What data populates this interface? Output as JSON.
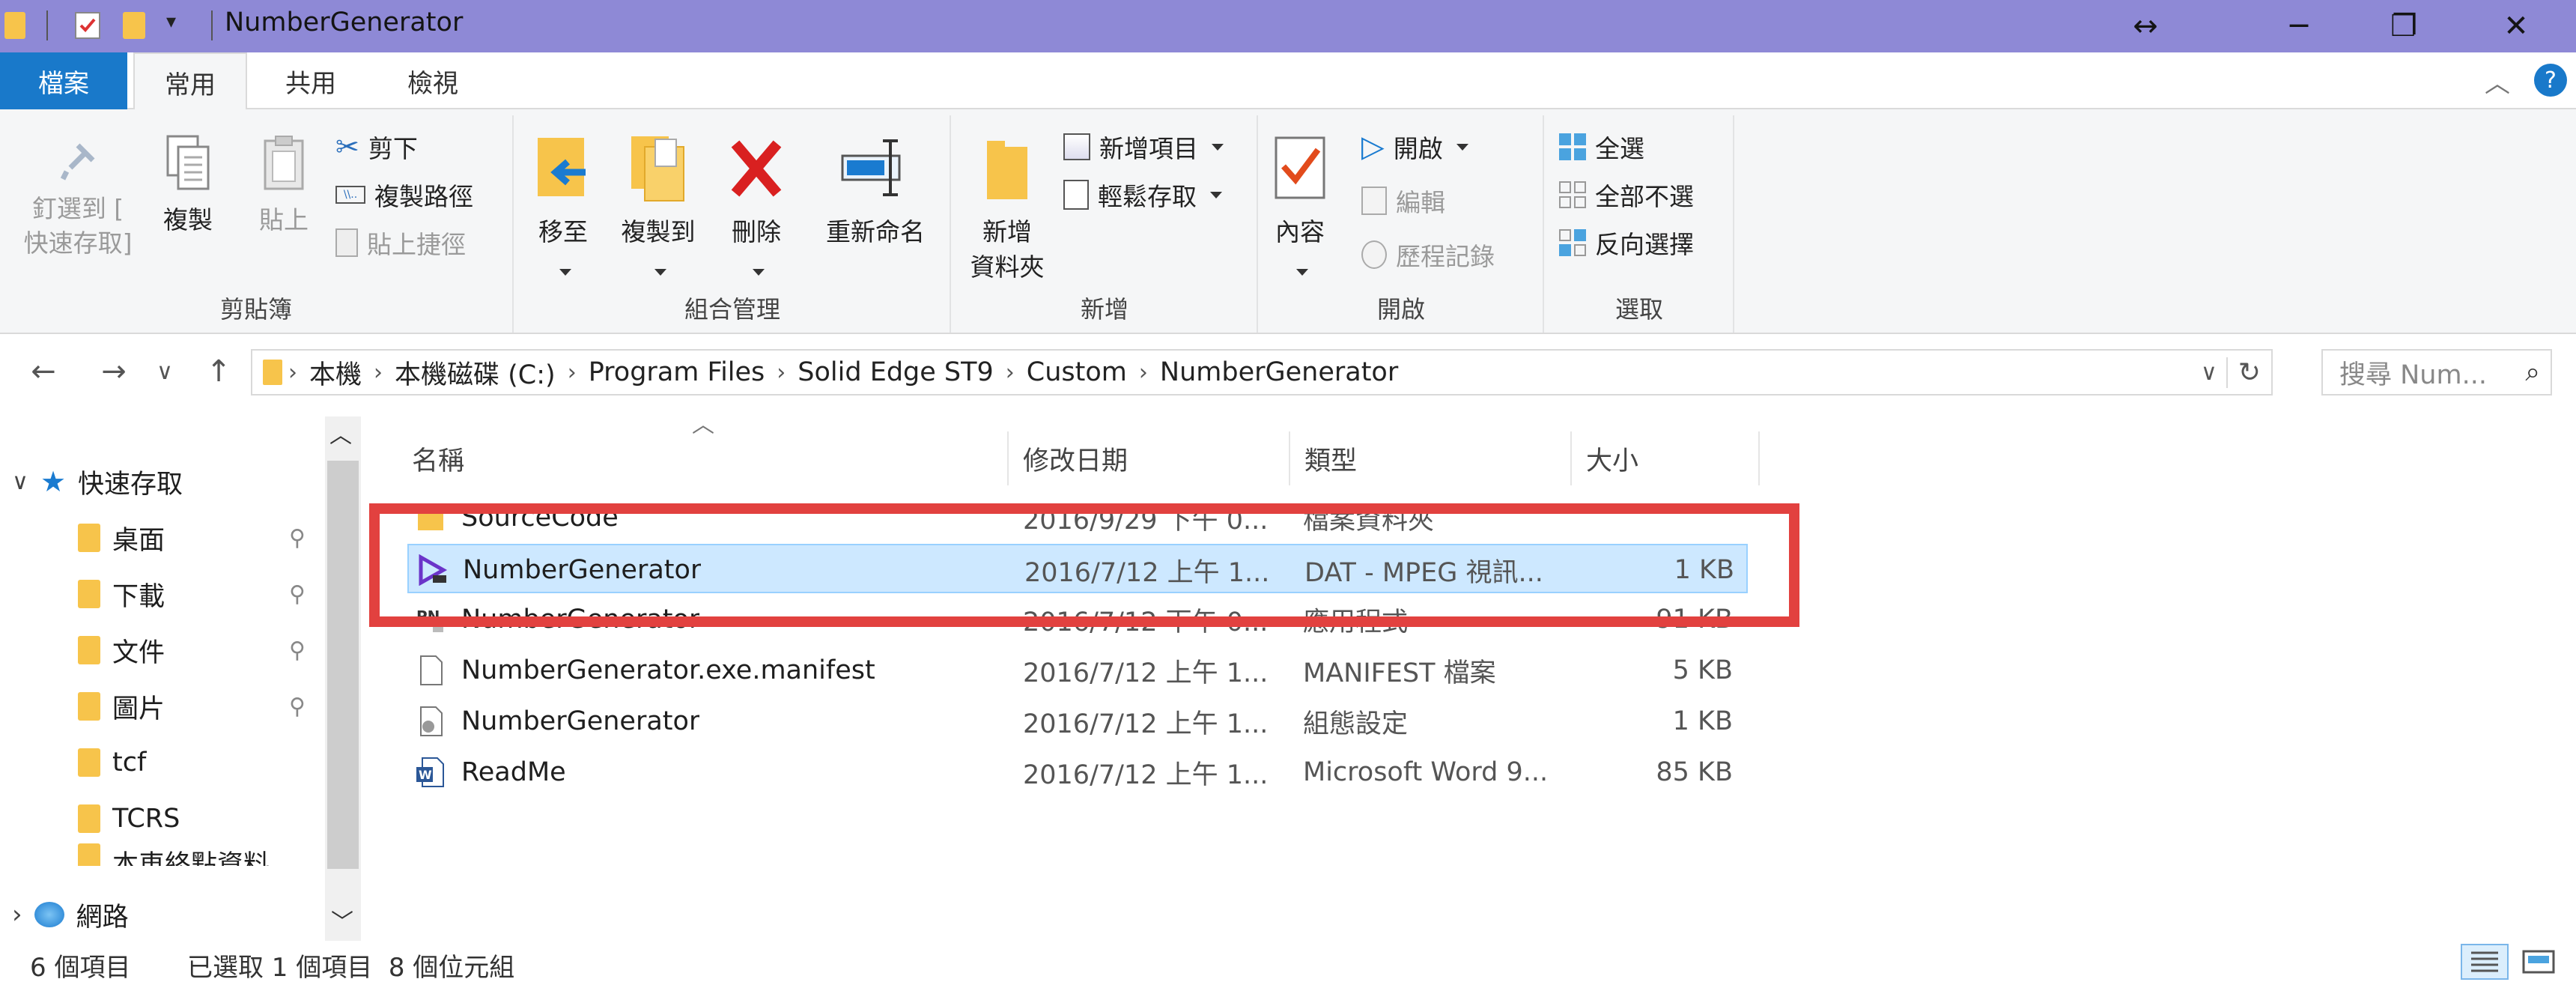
{
  "window": {
    "title": "NumberGenerator",
    "title_bar_color": "#8e89d6",
    "resize_glyph": "↔",
    "minimize_glyph": "─",
    "restore_glyph": "❐",
    "close_glyph": "✕"
  },
  "menu": {
    "tabs": [
      "檔案",
      "常用",
      "共用",
      "檢視"
    ],
    "active_tab": "常用",
    "collapse_glyph": "︿",
    "help_glyph": "?"
  },
  "ribbon": {
    "clipboard": {
      "label": "剪貼簿",
      "pin_label": "釘選到 [\n快速存取]",
      "copy_label": "複製",
      "paste_label": "貼上",
      "cut_label": "剪下",
      "copy_path_label": "複製路徑",
      "paste_shortcut_label": "貼上捷徑"
    },
    "organize": {
      "label": "組合管理",
      "move_to_label": "移至",
      "copy_to_label": "複製到",
      "delete_label": "刪除",
      "rename_label": "重新命名"
    },
    "new": {
      "label": "新增",
      "new_folder_label": "新增\n資料夾",
      "new_item_label": "新增項目",
      "easy_access_label": "輕鬆存取"
    },
    "open": {
      "label": "開啟",
      "properties_label": "內容",
      "open_label": "開啟",
      "edit_label": "編輯",
      "history_label": "歷程記錄"
    },
    "select": {
      "label": "選取",
      "select_all_label": "全選",
      "select_none_label": "全部不選",
      "invert_label": "反向選擇"
    }
  },
  "address": {
    "breadcrumbs": [
      "本機",
      "本機磁碟 (C:)",
      "Program Files",
      "Solid Edge ST9",
      "Custom",
      "NumberGenerator"
    ],
    "separator": "›",
    "search_placeholder": "搜尋 Num...",
    "back_glyph": "←",
    "forward_glyph": "→",
    "recent_glyph": "∨",
    "up_glyph": "↑",
    "refresh_glyph": "↻",
    "dropdown_glyph": "∨",
    "search_glyph": "⌕"
  },
  "navpane": {
    "quick_access_label": "快速存取",
    "items": [
      {
        "label": "桌面",
        "pinned": true
      },
      {
        "label": "下載",
        "pinned": true
      },
      {
        "label": "文件",
        "pinned": true
      },
      {
        "label": "圖片",
        "pinned": true
      },
      {
        "label": "tcf",
        "pinned": false
      },
      {
        "label": "TCRS",
        "pinned": false
      },
      {
        "label": "本車終點資料",
        "pinned": false
      }
    ],
    "network_label": "網路",
    "expand_glyph": "∨",
    "collapse_glyph": "›",
    "pin_glyph": "📌"
  },
  "columns": {
    "name": "名稱",
    "date": "修改日期",
    "type": "類型",
    "size": "大小",
    "sort_glyph": "︿"
  },
  "files": [
    {
      "name": "SourceCode",
      "date": "2016/9/29 下午 0...",
      "type": "檔案資料夾",
      "size": "",
      "icon": "folder-icon",
      "selected": false
    },
    {
      "name": "NumberGenerator",
      "date": "2016/7/12 上午 1...",
      "type": "DAT - MPEG 視訊...",
      "size": "1 KB",
      "icon": "dat-file-icon",
      "selected": true
    },
    {
      "name": "NumberGenerator",
      "date": "2016/7/12 下午 0...",
      "type": "應用程式",
      "size": "91 KB",
      "icon": "exe-file-icon",
      "selected": false
    },
    {
      "name": "NumberGenerator.exe.manifest",
      "date": "2016/7/12 上午 1...",
      "type": "MANIFEST 檔案",
      "size": "5 KB",
      "icon": "blank-file-icon",
      "selected": false
    },
    {
      "name": "NumberGenerator",
      "date": "2016/7/12 上午 1...",
      "type": "組態設定",
      "size": "1 KB",
      "icon": "config-file-icon",
      "selected": false
    },
    {
      "name": "ReadMe",
      "date": "2016/7/12 上午 1...",
      "type": "Microsoft Word 9...",
      "size": "85 KB",
      "icon": "word-file-icon",
      "selected": false
    }
  ],
  "status": {
    "item_count": "6 個項目",
    "selection": "已選取 1 個項目  8 個位元組"
  },
  "colors": {
    "accent": "#1979ca",
    "selection": "#cde8ff",
    "highlight_box": "#e2413f"
  }
}
